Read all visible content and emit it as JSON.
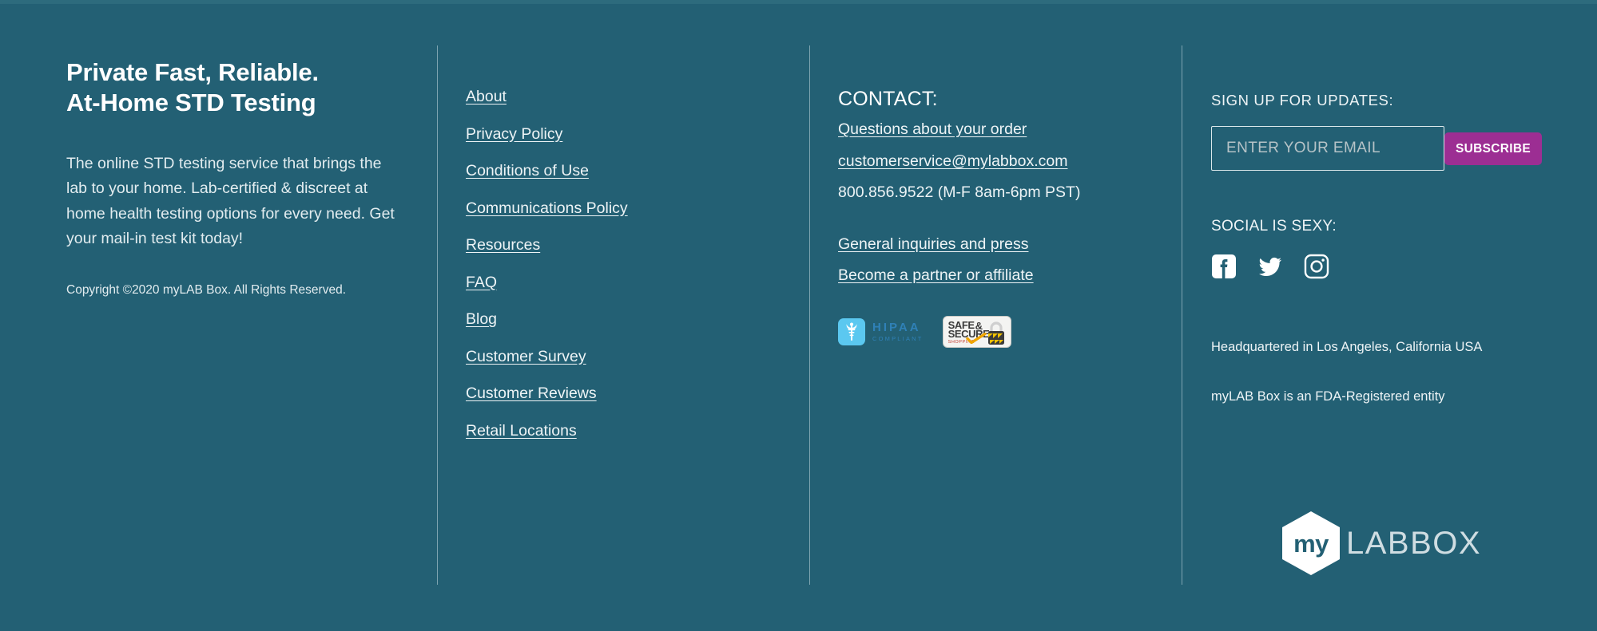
{
  "theme": {
    "background": "#236074",
    "accent_button": "#9c2e93",
    "text_light": "#eef4f6",
    "divider": "#9dbcc6",
    "hipaa_blue": "#5bc8f0",
    "logo_word": "#cfdde2"
  },
  "about": {
    "title_line1": "Private Fast, Reliable.",
    "title_line2": "At-Home STD Testing",
    "body": "The online STD testing service that brings the lab to your home. Lab-certified & discreet at home health testing options for every need. Get your mail-in test kit today!",
    "copyright": "Copyright ©2020 myLAB Box. All Rights Reserved."
  },
  "links": {
    "items": [
      {
        "label": "About"
      },
      {
        "label": "Privacy Policy"
      },
      {
        "label": "Conditions of Use"
      },
      {
        "label": "Communications Policy"
      },
      {
        "label": "Resources"
      },
      {
        "label": "FAQ"
      },
      {
        "label": "Blog"
      },
      {
        "label": "Customer Survey"
      },
      {
        "label": "Customer Reviews"
      },
      {
        "label": "Retail Locations"
      }
    ]
  },
  "contact": {
    "title": "CONTACT:",
    "questions_link": "Questions about your order",
    "email": "customerservice@mylabbox.com",
    "phone": "800.856.9522 (M-F 8am-6pm PST)",
    "general_inquiries_link": "General inquiries and press",
    "partner_link": "Become a partner or affiliate",
    "badges": {
      "hipaa": {
        "icon": "caduceus-icon",
        "title": "HIPAA",
        "subtitle": "COMPLIANT"
      },
      "secure": {
        "line1": "SAFE",
        "amp": "&",
        "line2": "SECURE",
        "line3": "SHOPPING",
        "icon": "padlock-icon"
      }
    }
  },
  "signup": {
    "title": "SIGN UP FOR UPDATES:",
    "email_placeholder": "ENTER YOUR EMAIL",
    "email_value": "",
    "subscribe_label": "SUBSCRIBE",
    "social_title": "SOCIAL IS SEXY:",
    "social": [
      {
        "name": "facebook-icon"
      },
      {
        "name": "twitter-icon"
      },
      {
        "name": "instagram-icon"
      }
    ],
    "headquarters": "Headquartered in Los Angeles, California USA",
    "fda": "myLAB Box is an FDA-Registered entity"
  },
  "logo": {
    "hex_text": "my",
    "word": "LABBOX"
  }
}
